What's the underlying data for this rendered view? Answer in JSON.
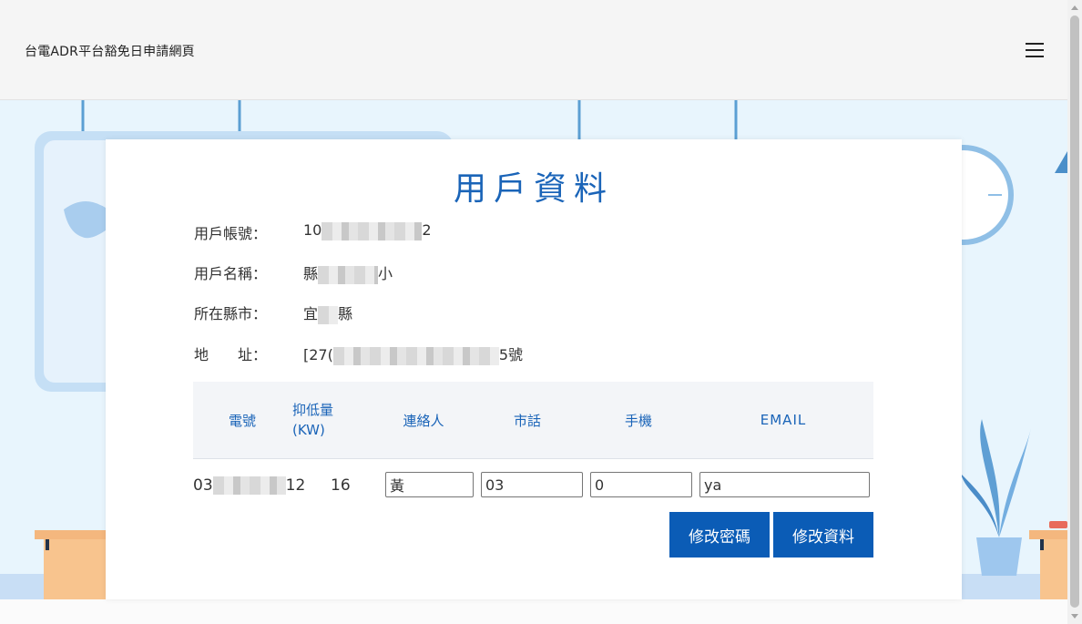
{
  "header": {
    "site_title": "台電ADR平台豁免日申請網頁"
  },
  "card": {
    "title": "用戶資料",
    "info": [
      {
        "label": "用戶帳號：",
        "value_prefix": "10",
        "value_suffix": "2"
      },
      {
        "label": "用戶名稱：",
        "value_prefix": "縣",
        "value_suffix": "小"
      },
      {
        "label": "所在縣市：",
        "value_prefix": "宜",
        "value_suffix": "縣"
      },
      {
        "label": "地　　址：",
        "value_prefix": "[27(",
        "value_suffix": "5號"
      }
    ],
    "table": {
      "headers": [
        "電號",
        "抑低量\n(KW)",
        "連絡人",
        "市話",
        "手機",
        "EMAIL"
      ],
      "row": {
        "meter_prefix": "03",
        "meter_suffix": "12",
        "reduction": "16",
        "contact": "黃",
        "phone": "03",
        "mobile": "0",
        "email": "ya"
      }
    },
    "buttons": {
      "change_password": "修改密碼",
      "edit_profile": "修改資料"
    }
  },
  "colors": {
    "accent": "#1a64b8",
    "button": "#0b5cb6",
    "background_scene": "#e8f5fd"
  }
}
